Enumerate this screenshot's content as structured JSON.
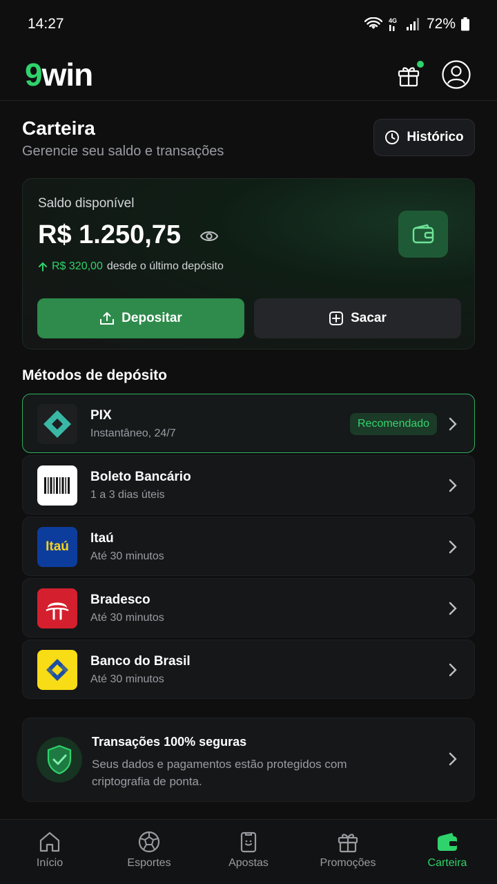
{
  "status_bar": {
    "time": "14:27",
    "battery": "72%"
  },
  "brand": {
    "logo_num": "9",
    "logo_rest": "win",
    "accent": "#2fd36b"
  },
  "page": {
    "title": "Carteira",
    "subtitle": "Gerencie seu saldo e transações",
    "history_label": "Histórico"
  },
  "balance": {
    "label": "Saldo disponível",
    "value": "R$ 1.250,75",
    "delta_amount": "R$ 320,00",
    "delta_text": "desde o último depósito",
    "deposit_label": "Depositar",
    "withdraw_label": "Sacar"
  },
  "methods_section": {
    "title": "Métodos de depósito",
    "items": [
      {
        "name": "PIX",
        "sub": "Instantâneo, 24/7",
        "badge": "Recomendado"
      },
      {
        "name": "Boleto Bancário",
        "sub": "1 a 3 dias úteis"
      },
      {
        "name": "Itaú",
        "sub": "Até 30 minutos",
        "logo_text": "Itaú"
      },
      {
        "name": "Bradesco",
        "sub": "Até 30 minutos"
      },
      {
        "name": "Banco do Brasil",
        "sub": "Até 30 minutos"
      }
    ]
  },
  "security": {
    "title": "Transações 100% seguras",
    "desc": "Seus dados e pagamentos estão protegidos com criptografia de ponta."
  },
  "nav": {
    "items": [
      {
        "label": "Início",
        "icon": "home-icon"
      },
      {
        "label": "Esportes",
        "icon": "soccer-ball-icon"
      },
      {
        "label": "Apostas",
        "icon": "ticket-icon"
      },
      {
        "label": "Promoções",
        "icon": "gift-icon"
      },
      {
        "label": "Carteira",
        "icon": "wallet-icon",
        "active": true
      }
    ]
  }
}
